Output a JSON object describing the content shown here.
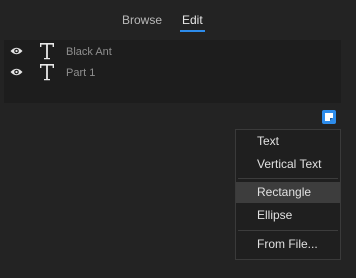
{
  "tabs": [
    {
      "label": "Browse",
      "active": false
    },
    {
      "label": "Edit",
      "active": true
    }
  ],
  "accent_color": "#2d8ceb",
  "layers": [
    {
      "name": "Black Ant",
      "visible": true,
      "type_icon": "text-layer-icon"
    },
    {
      "name": "Part 1",
      "visible": true,
      "type_icon": "text-layer-icon"
    }
  ],
  "new_item_button_icon": "new-layer-icon",
  "menu": {
    "items": [
      {
        "label": "Text"
      },
      {
        "label": "Vertical Text"
      },
      {
        "label": "Rectangle",
        "highlighted": true
      },
      {
        "label": "Ellipse"
      },
      {
        "label": "From File..."
      }
    ]
  }
}
